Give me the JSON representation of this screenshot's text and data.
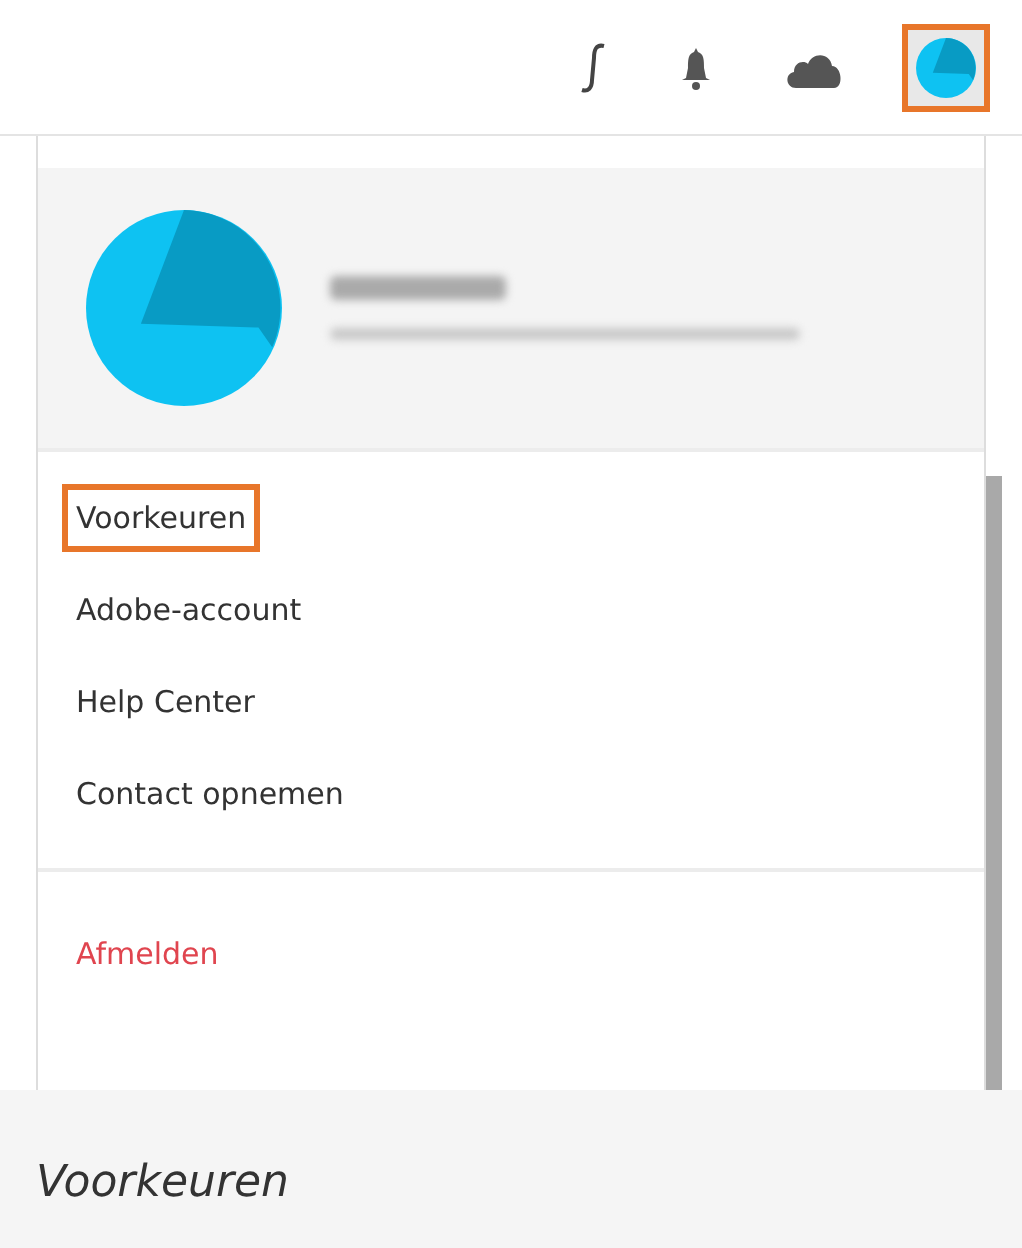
{
  "topbar": {
    "icons": [
      {
        "kind": "script",
        "highlighted": false
      },
      {
        "kind": "bell",
        "highlighted": false
      },
      {
        "kind": "cloud",
        "highlighted": false
      },
      {
        "kind": "avatar",
        "highlighted": true
      }
    ]
  },
  "menu": {
    "groups": [
      {
        "items": [
          {
            "label": "Voorkeuren",
            "kind": "normal",
            "highlighted": true
          },
          {
            "label": "Adobe-account",
            "kind": "normal",
            "highlighted": false
          },
          {
            "label": "Help Center",
            "kind": "normal",
            "highlighted": false
          },
          {
            "label": "Contact opnemen",
            "kind": "normal",
            "highlighted": false
          }
        ]
      },
      {
        "items": [
          {
            "label": "Afmelden",
            "kind": "danger",
            "highlighted": false
          }
        ]
      }
    ]
  },
  "caption": "Voorkeuren"
}
